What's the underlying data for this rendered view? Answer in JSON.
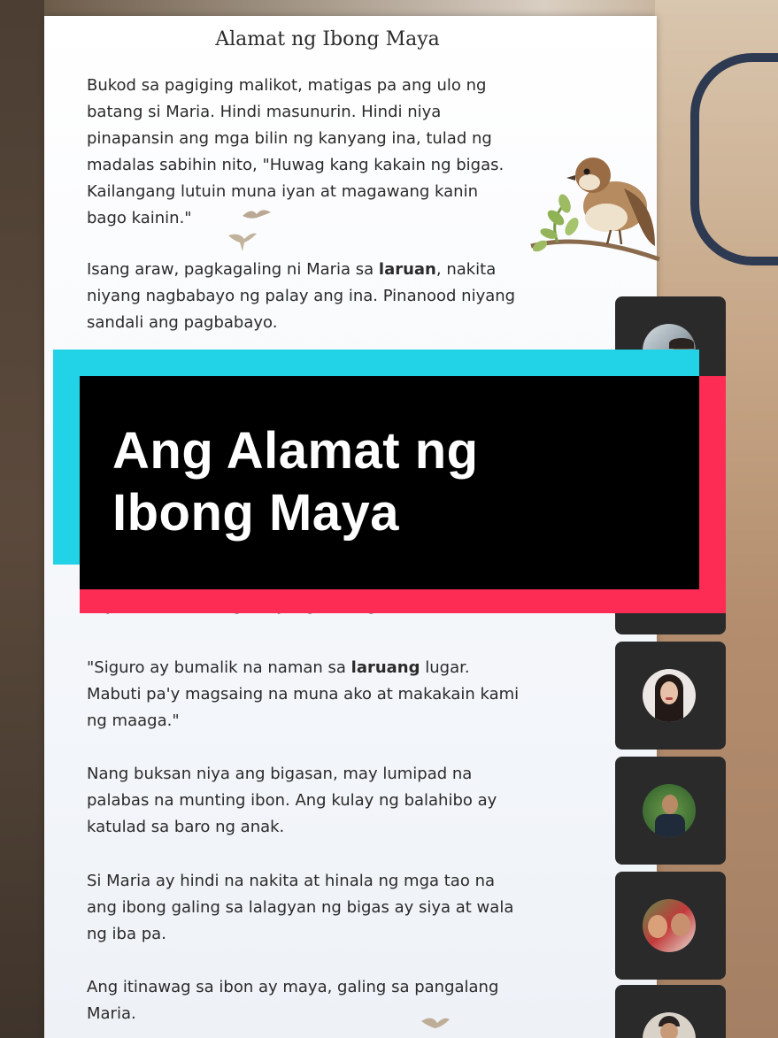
{
  "document": {
    "title": "Alamat ng Ibong Maya",
    "paragraphs": [
      {
        "lines": [
          "Bukod sa pagiging malikot, matigas pa ang ulo ng",
          "batang si Maria. Hindi masunurin. Hindi niya",
          "pinapansin ang mga bilin ng kanyang ina, tulad ng",
          "madalas sabihin nito, \"Huwag kang kakain ng bigas.",
          "Kailangang lutuin muna iyan at magawang kanin",
          "bago kainin.\""
        ]
      },
      {
        "line1_pre": "Isang araw, pagkagaling ni Maria sa ",
        "line1_bold": "laruan",
        "line1_post": ", nakita",
        "lines_rest": [
          "niyang nagbabayo ng palay ang ina. Pinanood niyang",
          "sandali ang pagbabayo."
        ]
      },
      {
        "cut_line": "kaya si Maria?\" ang kanyang tanong."
      },
      {
        "line1_pre": "\"Siguro ay bumalik na naman sa ",
        "line1_bold": "laruang",
        "line1_post": " lugar.",
        "lines_rest": [
          "Mabuti pa'y magsaing na muna ako at makakain kami",
          "ng maaga.\""
        ]
      },
      {
        "lines": [
          "Nang buksan niya ang bigasan, may lumipad na",
          "palabas na munting ibon. Ang kulay ng balahibo ay",
          "katulad sa baro ng anak."
        ]
      },
      {
        "lines": [
          "Si Maria ay hindi na nakita at hinala ng mga tao na",
          "ang ibong galing sa lalagyan ng bigas ay siya at wala",
          "ng iba pa."
        ]
      },
      {
        "lines": [
          "Ang itinawag sa ibon ay maya, galing sa pangalang",
          "Maria."
        ]
      }
    ]
  },
  "banner": {
    "line1": "Ang Alamat ng",
    "line2": "Ibong Maya"
  },
  "participants": [
    {
      "name": "",
      "avatar": "avatar-1"
    },
    {
      "name": "",
      "avatar": "avatar-2"
    },
    {
      "name": "",
      "avatar": "avatar-3"
    },
    {
      "name": "",
      "avatar": "avatar-4"
    },
    {
      "name": "",
      "avatar": "avatar-5"
    },
    {
      "name": "",
      "avatar": "avatar-6"
    }
  ],
  "colors": {
    "banner_cyan": "#22d2e6",
    "banner_red": "#fd2c55",
    "banner_black": "#000000",
    "banner_text": "#ffffff"
  }
}
